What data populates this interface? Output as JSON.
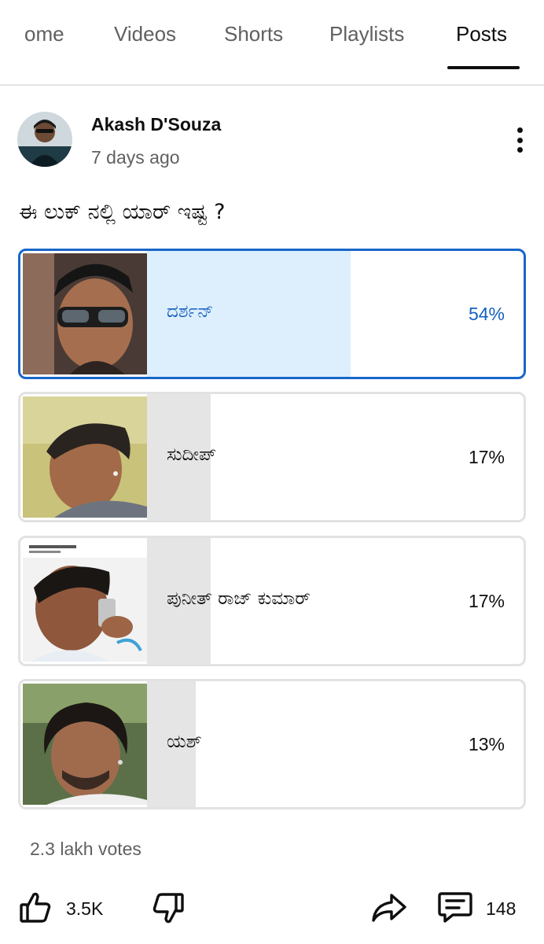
{
  "tabs": [
    {
      "label": "ome",
      "active": false
    },
    {
      "label": "Videos",
      "active": false
    },
    {
      "label": "Shorts",
      "active": false
    },
    {
      "label": "Playlists",
      "active": false
    },
    {
      "label": "Posts",
      "active": true
    }
  ],
  "post": {
    "author": "Akash D'Souza",
    "time": "7 days ago",
    "question": "ಈ ಲುಕ್ ನಲ್ಲಿ ಯಾರ್ ಇಷ್ಟ ?",
    "poll": {
      "options": [
        {
          "label": "ದರ್ಶನ್",
          "percent": "54%",
          "fraction": 0.54,
          "selected": true
        },
        {
          "label": "ಸುದೀಪ್",
          "percent": "17%",
          "fraction": 0.17,
          "selected": false
        },
        {
          "label": "ಪುನೀತ್ ರಾಜ್ ಕುಮಾರ್",
          "percent": "17%",
          "fraction": 0.17,
          "selected": false
        },
        {
          "label": "ಯಶ್",
          "percent": "13%",
          "fraction": 0.13,
          "selected": false
        }
      ],
      "votes": "2.3 lakh votes"
    },
    "actions": {
      "likes": "3.5K",
      "comments": "148"
    }
  },
  "colors": {
    "accent": "#1867c8",
    "selected_fill": "#ddeefc",
    "bar_fill": "#e5e5e5"
  },
  "icons": [
    "more-vert-icon",
    "thumb-up-icon",
    "thumb-down-icon",
    "share-icon",
    "comment-icon"
  ]
}
